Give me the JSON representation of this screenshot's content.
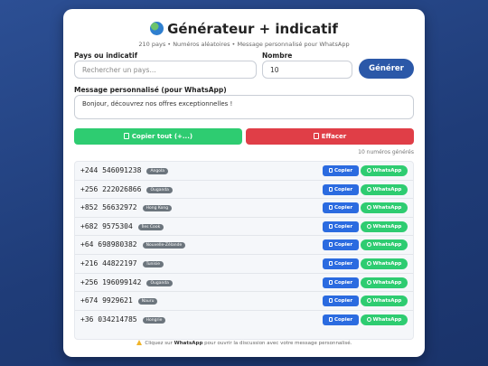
{
  "header": {
    "title": "Générateur + indicatif",
    "subtitle": "210 pays • Numéros aléatoires • Message personnalisé pour WhatsApp"
  },
  "form": {
    "country_label": "Pays ou indicatif",
    "country_placeholder": "Rechercher un pays...",
    "count_label": "Nombre",
    "count_value": "10",
    "generate_label": "Générer",
    "message_label": "Message personnalisé (pour WhatsApp)",
    "message_value": "Bonjour, découvrez nos offres exceptionnelles !"
  },
  "actions": {
    "copy_all_label": "Copier tout (+...)",
    "clear_label": "Effacer",
    "generated_count": "10 numéros générés"
  },
  "numbers": [
    {
      "number": "+244 546091238",
      "country": "Angola"
    },
    {
      "number": "+256 222026866",
      "country": "Ouganda"
    },
    {
      "number": "+852 56632972",
      "country": "Hong Kong"
    },
    {
      "number": "+682 9575304",
      "country": "Îles Cook"
    },
    {
      "number": "+64 698980382",
      "country": "Nouvelle-Zélande"
    },
    {
      "number": "+216 44822197",
      "country": "Tunisie"
    },
    {
      "number": "+256 196099142",
      "country": "Ouganda"
    },
    {
      "number": "+674 9929621",
      "country": "Nauru"
    },
    {
      "number": "+36 034214785",
      "country": "Hongrie"
    }
  ],
  "row_buttons": {
    "copy_label": "Copier",
    "whatsapp_label": "WhatsApp"
  },
  "footer": {
    "before": "Cliquez sur",
    "bold": "WhatsApp",
    "after": "pour ouvrir la discussion avec votre message personnalisé."
  },
  "colors": {
    "background": "#22427f",
    "primary": "#2b58a8",
    "success": "#2ecc71",
    "danger": "#e03e47",
    "copy_blue": "#2b6be0"
  },
  "icons": {
    "title": "globe-icon",
    "copy": "clipboard-icon",
    "clear": "trash-icon",
    "whatsapp": "whatsapp-icon",
    "footer": "warning-icon"
  }
}
